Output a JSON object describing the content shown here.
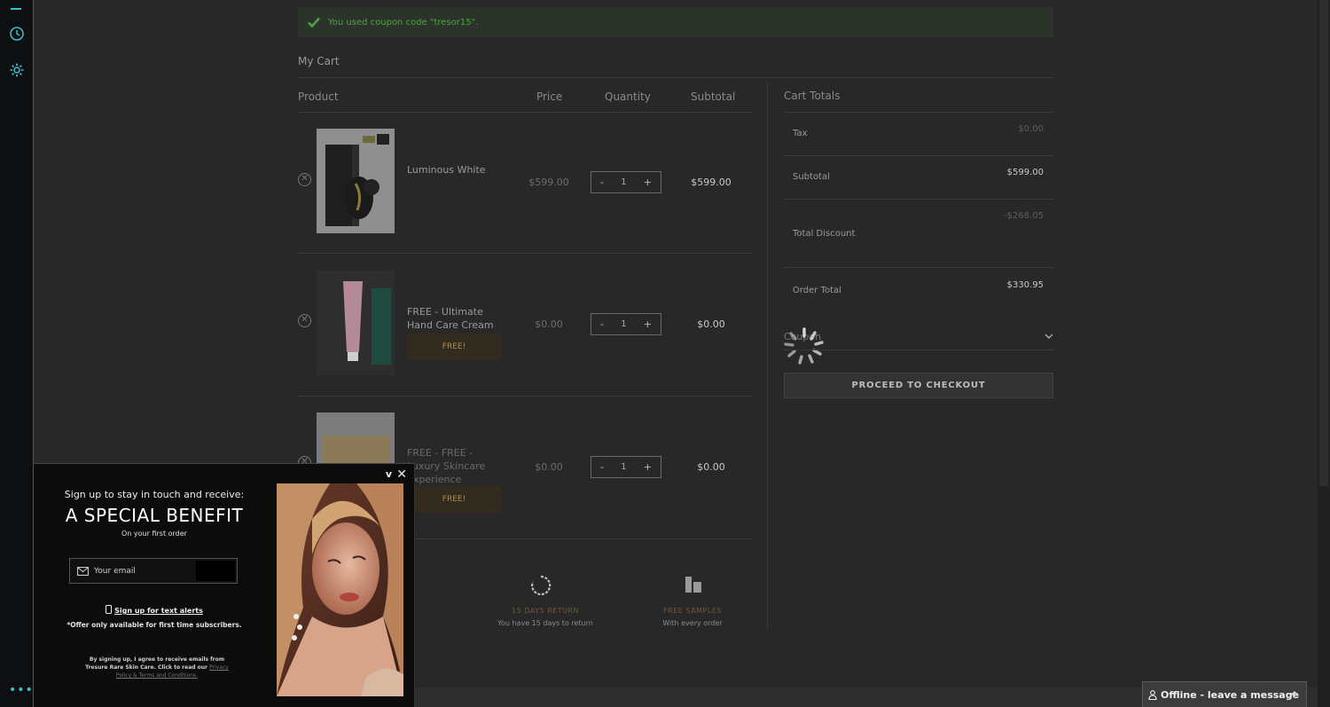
{
  "notice": {
    "text": "You used coupon code \"tresor15\"."
  },
  "cart": {
    "title": "My Cart",
    "columns": {
      "product": "Product",
      "price": "Price",
      "quantity": "Quantity",
      "subtotal": "Subtotal"
    },
    "items": [
      {
        "name": "Luminous White",
        "price": "$599.00",
        "qty": "1",
        "subtotal": "$599.00",
        "badge": ""
      },
      {
        "name": "FREE - Ultimate Hand Care Cream",
        "price": "$0.00",
        "qty": "1",
        "subtotal": "$0.00",
        "badge": "FREE!"
      },
      {
        "name": "FREE - FREE - Luxury Skincare Experience",
        "price": "$0.00",
        "qty": "1",
        "subtotal": "$0.00",
        "badge": "FREE!"
      }
    ],
    "qty_minus": "-",
    "qty_plus": "+"
  },
  "totals": {
    "title": "Cart Totals",
    "tax_label": "Tax",
    "tax": "$0.00",
    "subtotal_label": "Subtotal",
    "subtotal": "$599.00",
    "discount_label": "Total Discount",
    "discount": "-$268.05",
    "order_total_label": "Order Total",
    "order_total": "$330.95",
    "coupon_label": "Coupon",
    "checkout_label": "PROCEED TO CHECKOUT"
  },
  "features": [
    {
      "title": "15 DAYS RETURN",
      "sub": "You have 15 days to return"
    },
    {
      "title": "FREE SAMPLES",
      "sub": "With every order"
    }
  ],
  "popup": {
    "lead": "Sign up to stay in touch and receive:",
    "headline": "A SPECIAL BENEFIT",
    "sub": "On your first order",
    "email_placeholder": "Your email",
    "sms_link": "Sign up for text alerts",
    "offer_note": "*Offer only available for first time subscribers.",
    "legal": "By signing up, I agree to receive emails from Tresure Rare Skin Care. Click to read our",
    "legal_link": "Privacy Policy & Terms and Conditions.",
    "minimize": "v",
    "close": "✕"
  },
  "chat": {
    "label": "Offline - leave a message"
  },
  "colors": {
    "accent": "#3bc2cf",
    "success": "#4fa343",
    "gold": "#b88a3c",
    "background": "#282828"
  }
}
